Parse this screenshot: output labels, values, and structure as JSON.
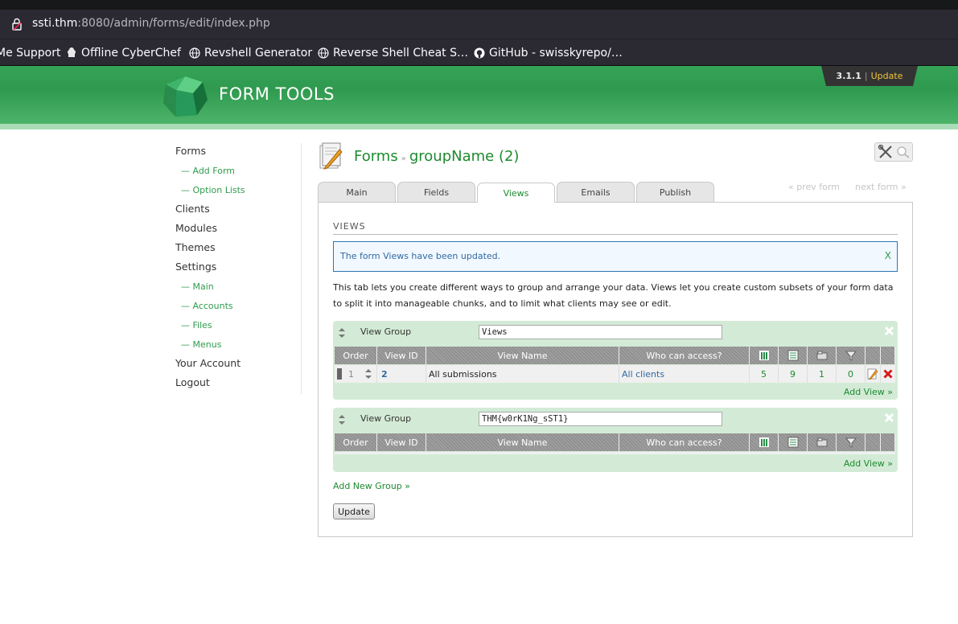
{
  "browser": {
    "url_host": "ssti.thm",
    "url_rest": ":8080/admin/forms/edit/index.php",
    "bookmarks": [
      "Me Support",
      "Offline CyberChef",
      "Revshell Generator",
      "Reverse Shell Cheat S…",
      "GitHub - swisskyrepo/…"
    ]
  },
  "header": {
    "logo_text": "FORM TOOLS",
    "version": "3.1.1",
    "separator": "|",
    "update_label": "Update"
  },
  "nav": {
    "items": [
      {
        "label": "Forms",
        "type": "main"
      },
      {
        "label": "— Add Form",
        "type": "sub"
      },
      {
        "label": "— Option Lists",
        "type": "sub"
      },
      {
        "label": "Clients",
        "type": "main"
      },
      {
        "label": "Modules",
        "type": "main"
      },
      {
        "label": "Themes",
        "type": "main"
      },
      {
        "label": "Settings",
        "type": "main"
      },
      {
        "label": "— Main",
        "type": "sub"
      },
      {
        "label": "— Accounts",
        "type": "sub"
      },
      {
        "label": "— Files",
        "type": "sub"
      },
      {
        "label": "— Menus",
        "type": "sub"
      },
      {
        "label": "Your Account",
        "type": "main"
      },
      {
        "label": "Logout",
        "type": "main"
      }
    ]
  },
  "page": {
    "breadcrumb_root": "Forms",
    "breadcrumb_sep": "»",
    "form_name": "groupName (2)",
    "prev_form": "« prev form",
    "next_form": "next form »"
  },
  "tabs": [
    "Main",
    "Fields",
    "Views",
    "Emails",
    "Publish"
  ],
  "active_tab": "Views",
  "views": {
    "section_title": "VIEWS",
    "notice": "The form Views have been updated.",
    "notice_close": "X",
    "description": "This tab lets you create different ways to group and arrange your data. Views let you create custom subsets of your form data to split it into manageable chunks, and to limit what clients may see or edit.",
    "columns": {
      "order": "Order",
      "view_id": "View ID",
      "view_name": "View Name",
      "who_can_access": "Who can access?"
    },
    "group_label": "View Group",
    "groups": [
      {
        "name": "Views",
        "rows": [
          {
            "order": "1",
            "view_id": "2",
            "view_name": "All submissions",
            "access": "All clients",
            "col1": "5",
            "col2": "9",
            "col3": "1",
            "col4": "0"
          }
        ]
      },
      {
        "name": "THM{w0rK1Ng_sST1}",
        "rows": []
      }
    ],
    "add_view": "Add View »",
    "add_group": "Add New Group »",
    "update_button": "Update"
  },
  "colors": {
    "header_green": "#2f9a4f",
    "link_green": "#1d8a2f",
    "group_bg": "#d3ebd6",
    "notice_border": "#2f76b0"
  }
}
